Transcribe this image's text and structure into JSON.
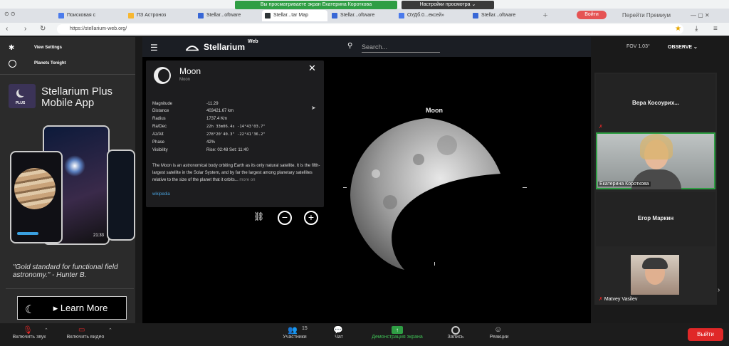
{
  "banner": {
    "sharing": "Вы просматриваете экран Екатерина Короткова",
    "view_options": "Настройки просмотра ⌄"
  },
  "browser": {
    "tabs": [
      {
        "label": "Поисковая с",
        "color": "#4b7bec"
      },
      {
        "label": "ПЗ Астроноз",
        "color": "#f7b731"
      },
      {
        "label": "Stellar...oftware",
        "color": "#3867d6"
      },
      {
        "label": "Stellar...tar Map",
        "color": "#2d3436"
      },
      {
        "label": "Stellar...oftware",
        "color": "#3867d6"
      },
      {
        "label": "ОУДб.0...ексей»",
        "color": "#4b7bec"
      },
      {
        "label": "Stellar...oftware",
        "color": "#3867d6"
      }
    ],
    "url": "https://stellarium-web.org/",
    "vote_label": "Войти",
    "premium_label": "Перейти Премиум"
  },
  "left": {
    "view_settings": "View Settings",
    "planets_tonight": "Planets Tonight",
    "promo_title": "Stellarium Plus Mobile App",
    "logo_badge": "PLUS",
    "quote": "\"Gold standard for functional field astronomy.\" - Hunter B.",
    "learn_more": "▸ Learn More",
    "phone_time": "21:33"
  },
  "stellarium": {
    "brand": "Stellarium",
    "brand_sup": "Web",
    "search_placeholder": "Search...",
    "fov": "FOV 1.03°",
    "observe": "OBSERVE ⌄",
    "moon_label": "Moon"
  },
  "info": {
    "title": "Moon",
    "subtitle": "Moon",
    "rows": [
      {
        "label": "Magnitude",
        "value": "-11.29"
      },
      {
        "label": "Distance",
        "value": "403421.67 km"
      },
      {
        "label": "Radius",
        "value": "1737.4 Km"
      },
      {
        "label": "Ra/Dec",
        "value": "22h 33m06.4s  -14°43'03.7\""
      },
      {
        "label": "Az/Alt",
        "value": "278°20'40.3\"  -22°41'36.2\""
      },
      {
        "label": "Phase",
        "value": "42%"
      },
      {
        "label": "Visibility",
        "value": "Rise: 02:48   Set: 11:40"
      }
    ],
    "description": "The Moon is an astronomical body orbiting Earth as its only natural satellite. It is the fifth-largest satellite in the Solar System, and by far the largest among planetary satellites relative to the size of the planet that it orbits...",
    "more": "more on",
    "wiki": "wikipedia"
  },
  "participants": [
    {
      "name": "Вера Косоурих..."
    },
    {
      "name": "Екатерина Короткова"
    },
    {
      "name": "Егор Маркин"
    },
    {
      "name": "Matvey Vasilev"
    }
  ],
  "zoom": {
    "mute": "Включить звук",
    "video": "Включить видео",
    "participants": "Участники",
    "participants_count": "15",
    "chat": "Чат",
    "share": "Демонстрация экрана",
    "record": "Запись",
    "reactions": "Реакции",
    "leave": "Выйти"
  },
  "colors": {
    "share_green": "#2f9e44",
    "leave_red": "#e02828"
  }
}
